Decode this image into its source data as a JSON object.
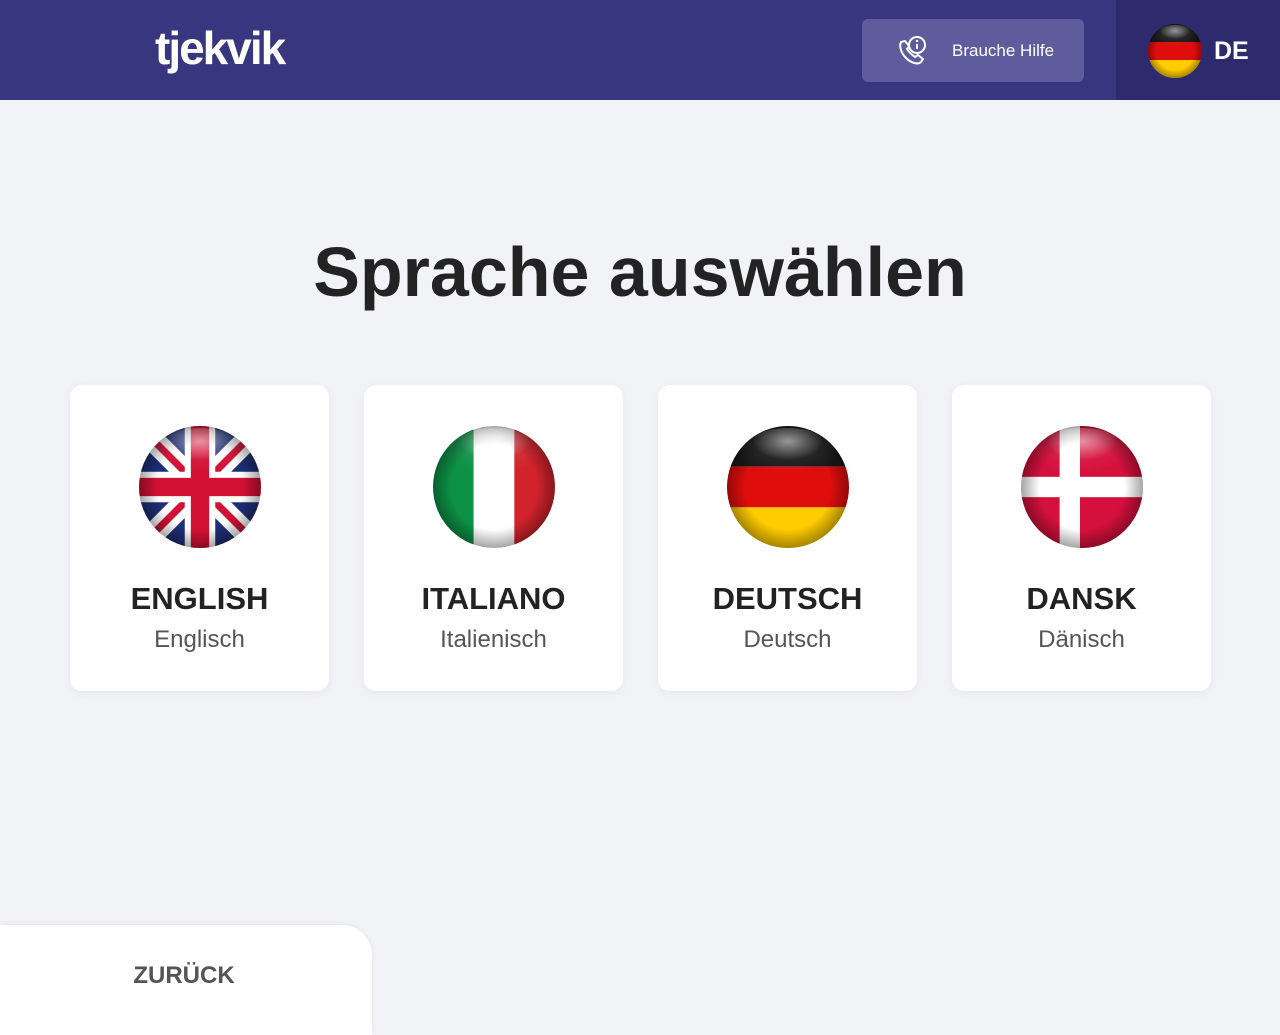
{
  "header": {
    "logo_text": "tjekvik",
    "help_button_label": "Brauche Hilfe",
    "help_icon": "phone-info-icon",
    "current_language_code": "DE",
    "current_language_flag": "germany-flag-icon",
    "background_color": "#393680"
  },
  "main": {
    "title": "Sprache auswählen",
    "languages": [
      {
        "name": "ENGLISH",
        "sub": "Englisch",
        "flag": "uk-flag-icon"
      },
      {
        "name": "ITALIANO",
        "sub": "Italienisch",
        "flag": "italy-flag-icon"
      },
      {
        "name": "DEUTSCH",
        "sub": "Deutsch",
        "flag": "germany-flag-icon"
      },
      {
        "name": "DANSK",
        "sub": "Dänisch",
        "flag": "denmark-flag-icon"
      }
    ]
  },
  "footer": {
    "back_label": "ZURÜCK"
  }
}
